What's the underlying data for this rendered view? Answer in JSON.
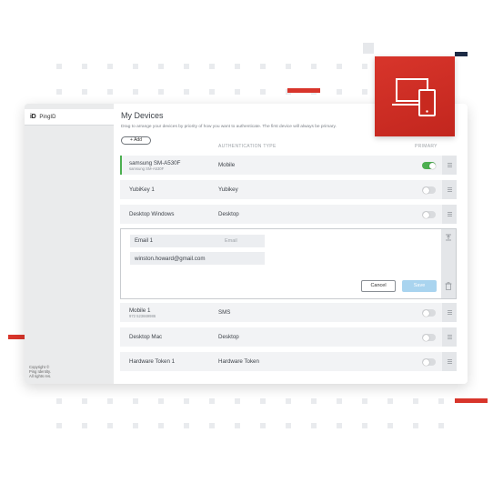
{
  "brand": {
    "logo": "iD",
    "name": "PingID"
  },
  "sidebar": {
    "copyright": "Copyright ©\nPing Identity.\nAll rights res."
  },
  "header": {
    "title": "My Devices",
    "subtitle": "Drag to arrange your devices by priority of how you want to authenticate. The first device will always be primary.",
    "add_label": "+ Add"
  },
  "columns": {
    "auth_type": "AUTHENTICATION TYPE",
    "primary": "PRIMARY"
  },
  "devices_top": [
    {
      "name": "samsung SM-A530F",
      "sub": "samsung SM-A530F",
      "type": "Mobile",
      "primary": true
    },
    {
      "name": "YubiKey 1",
      "sub": "",
      "type": "Yubikey",
      "primary": false
    },
    {
      "name": "Desktop Windows",
      "sub": "",
      "type": "Desktop",
      "primary": false
    }
  ],
  "edit_device": {
    "name": "Email 1",
    "type": "Email",
    "email": "winston.howard@gmail.com",
    "cancel_label": "Cancel",
    "save_label": "Save"
  },
  "devices_bottom": [
    {
      "name": "Mobile 1",
      "sub": "972 523669986",
      "type": "SMS",
      "primary": false
    },
    {
      "name": "Desktop Mac",
      "sub": "",
      "type": "Desktop",
      "primary": false
    },
    {
      "name": "Hardware Token 1",
      "sub": "",
      "type": "Hardware Token",
      "primary": false
    }
  ],
  "colors": {
    "accent_red": "#d8352b",
    "primary_green": "#4caf50",
    "save_blue": "#a9d4ef"
  },
  "icons": {
    "tile": "devices-icon",
    "drag": "drag-handle-icon",
    "trash": "trash-icon",
    "collapse": "collapse-icon"
  }
}
